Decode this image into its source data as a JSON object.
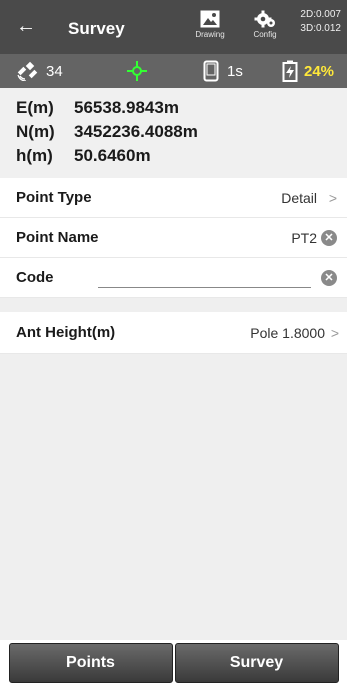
{
  "header": {
    "back_glyph": "←",
    "title": "Survey",
    "drawing_label": "Drawing",
    "config_label": "Config",
    "precision_2d": "2D:0.007",
    "precision_3d": "3D:0.012",
    "icons": {
      "back": "back-arrow-icon",
      "drawing": "drawing-image-icon",
      "config": "gear-icon"
    }
  },
  "status": {
    "satellites": "34",
    "interval": "1s",
    "battery": "24%",
    "colors": {
      "fix": "#33ff33",
      "battery": "#ffe83a"
    }
  },
  "coords": [
    {
      "key": "E(m)",
      "value": "56538.9843m"
    },
    {
      "key": "N(m)",
      "value": "3452236.4088m"
    },
    {
      "key": "h(m)",
      "value": "50.6460m"
    }
  ],
  "form": {
    "point_type": {
      "label": "Point Type",
      "value": "Detail"
    },
    "point_name": {
      "label": "Point Name",
      "value": "PT2"
    },
    "code": {
      "label": "Code",
      "value": ""
    }
  },
  "antenna": {
    "label": "Ant Height(m)",
    "value": "Pole 1.8000"
  },
  "bottom": {
    "points_label": "Points",
    "survey_label": "Survey"
  }
}
